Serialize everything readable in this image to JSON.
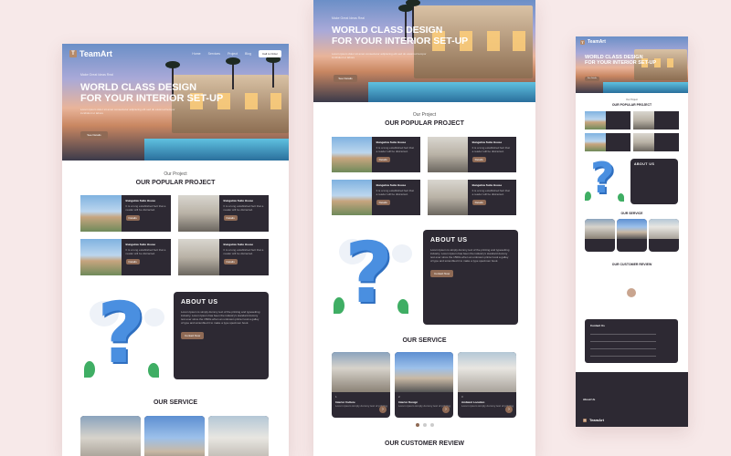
{
  "brand": {
    "name": "TeamArt",
    "mark": "T"
  },
  "nav": {
    "links": [
      "Home",
      "Services",
      "Project",
      "Blog"
    ],
    "cta": "Call to Order"
  },
  "hero": {
    "subtitle": "Make Great Ideas Real",
    "title_line1": "World class design",
    "title_line2": "for your interior set-up",
    "description": "Lorem ipsum dolor sit amet consectetur adipiscing elit sed do eiusmod tempor incididunt ut labore",
    "button": "See Details"
  },
  "projects": {
    "subtitle": "Our Project",
    "title": "OUR POPULAR PROJECT",
    "items": [
      {
        "title": "Bungalow Suite House",
        "desc": "It is a long established fact that a reader will be distracted.",
        "button": "Details"
      },
      {
        "title": "Bungalow Suite House",
        "desc": "It is a long established fact that a reader will be distracted.",
        "button": "Details"
      },
      {
        "title": "Bungalow Suite House",
        "desc": "It is a long established fact that a reader will be distracted.",
        "button": "Details"
      },
      {
        "title": "Bungalow Suite House",
        "desc": "It is a long established fact that a reader will be distracted.",
        "button": "Details"
      }
    ]
  },
  "about": {
    "title": "ABOUT US",
    "description": "Lorem Ipsum is simply dummy text of the printing and typesetting industry. Lorem Ipsum has been the industry's standard dummy text ever since the 1500s when an unknown printer took a galley of type and scrambled it to make a type specimen book.",
    "button": "Contact Now"
  },
  "services": {
    "title": "OUR SERVICE",
    "items": [
      {
        "num": "1",
        "title": "Interior Culture",
        "desc": "Lorem ipsum simply dummy text of printing"
      },
      {
        "num": "2",
        "title": "Interior Design",
        "desc": "Lorem ipsum simply dummy text of printing"
      },
      {
        "num": "3",
        "title": "Ambient Location",
        "desc": "Lorem ipsum simply dummy text of printing"
      }
    ]
  },
  "review": {
    "title": "OUR CUSTOMER REVIEW"
  },
  "contact": {
    "title": "Contact Us",
    "fields": [
      "Name",
      "Email",
      "Phone",
      "Message"
    ]
  },
  "footer": {
    "about_title": "About Us",
    "copyright": "Copyright © TeamArt"
  },
  "colors": {
    "accent": "#8f6a55",
    "dark": "#2d2933",
    "bg": "#f7e9e9"
  }
}
